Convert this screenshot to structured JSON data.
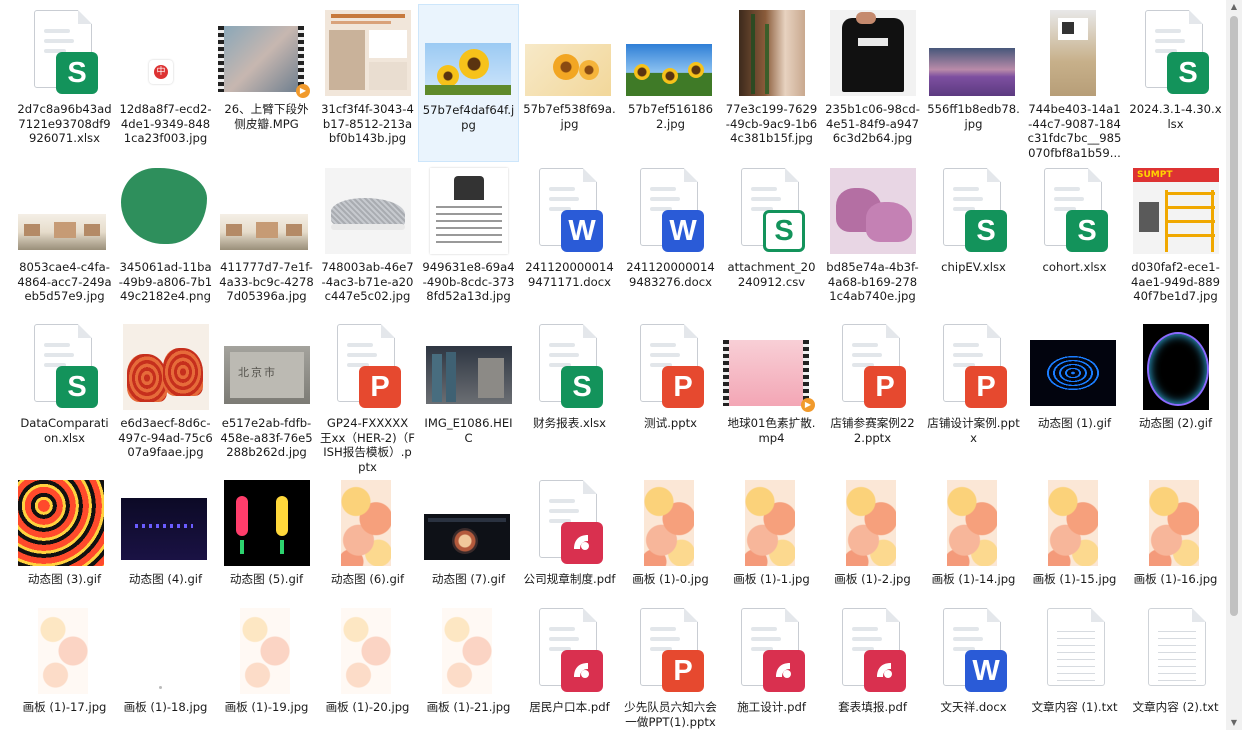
{
  "rows": [
    [
      {
        "name": "2d7c8a96b43ad7121e93708df9926071.xlsx",
        "kind": "xlsx"
      },
      {
        "name": "12d8a8f7-ecd2-4de1-9349-8481ca23f003.jpg",
        "kind": "img-seal"
      },
      {
        "name": "26、上臂下段外侧皮瓣.MPG",
        "kind": "video-skin"
      },
      {
        "name": "31cf3f4f-3043-4b17-8512-213abf0b143b.jpg",
        "kind": "img-poster"
      },
      {
        "name": "57b7ef4daf64f.jpg",
        "kind": "img-sunflower",
        "selected": true
      },
      {
        "name": "57b7ef538f69a.jpg",
        "kind": "img-flowers"
      },
      {
        "name": "57b7ef5161862.jpg",
        "kind": "img-sunfield"
      },
      {
        "name": "77e3c199-7629-49cb-9ac9-1b64c381b15f.jpg",
        "kind": "img-plant"
      },
      {
        "name": "235b1c06-98cd-4e51-84f9-a9476c3d2b64.jpg",
        "kind": "img-tshirt"
      },
      {
        "name": "556ff1b8edb78.jpg",
        "kind": "img-lavender"
      },
      {
        "name": "744be403-14a1-44c7-9087-184c31fdc7bc__985070fbf8a1b59...",
        "kind": "img-package"
      },
      {
        "name": "2024.3.1-4.30.xlsx",
        "kind": "xlsx"
      }
    ],
    [
      {
        "name": "8053cae4-c4fa-4864-acc7-249aeb5d57e9.jpg",
        "kind": "img-building"
      },
      {
        "name": "345061ad-11ba-49b9-a806-7b149c2182e4.png",
        "kind": "img-green"
      },
      {
        "name": "411777d7-7e1f-4a33-bc9c-42787d05396a.jpg",
        "kind": "img-building"
      },
      {
        "name": "748003ab-46e7-4ac3-b71e-a20c447e5c02.jpg",
        "kind": "img-shoe"
      },
      {
        "name": "949631e8-69a4-490b-8cdc-3738fd52a13d.jpg",
        "kind": "img-chart"
      },
      {
        "name": "2411200000149471171.docx",
        "kind": "docx"
      },
      {
        "name": "2411200000149483276.docx",
        "kind": "docx"
      },
      {
        "name": "attachment_20240912.csv",
        "kind": "csv"
      },
      {
        "name": "bd85e74a-4b3f-4a68-b169-2781c4ab740e.jpg",
        "kind": "img-slipper"
      },
      {
        "name": "chipEV.xlsx",
        "kind": "xlsx"
      },
      {
        "name": "cohort.xlsx",
        "kind": "xlsx"
      },
      {
        "name": "d030faf2-ece1-4ae1-949d-88940f7be1d7.jpg",
        "kind": "img-shelf"
      }
    ],
    [
      {
        "name": "DataComparation.xlsx",
        "kind": "xlsx"
      },
      {
        "name": "e6d3aecf-8d6c-497c-94ad-75c607a9faae.jpg",
        "kind": "img-redshoes"
      },
      {
        "name": "e517e2ab-fdfb-458e-a83f-76e5288b262d.jpg",
        "kind": "img-stone"
      },
      {
        "name": "GP24-FXXXXX 王xx（HER-2)（FISH报告模板）.pptx",
        "kind": "pptx"
      },
      {
        "name": "IMG_E1086.HEIC",
        "kind": "img-warehouse"
      },
      {
        "name": "财务报表.xlsx",
        "kind": "xlsx"
      },
      {
        "name": "测试.pptx",
        "kind": "pptx"
      },
      {
        "name": "地球01色素扩散.mp4",
        "kind": "video-pink"
      },
      {
        "name": "店铺参赛案例222.pptx",
        "kind": "pptx"
      },
      {
        "name": "店铺设计案例.pptx",
        "kind": "pptx"
      },
      {
        "name": "动态图 (1).gif",
        "kind": "img-ripple"
      },
      {
        "name": "动态图 (2).gif",
        "kind": "img-bubble"
      }
    ],
    [
      {
        "name": "动态图 (3).gif",
        "kind": "img-hex"
      },
      {
        "name": "动态图 (4).gif",
        "kind": "img-dots"
      },
      {
        "name": "动态图 (5).gif",
        "kind": "img-figures"
      },
      {
        "name": "动态图 (6).gif",
        "kind": "img-coral"
      },
      {
        "name": "动态图 (7).gif",
        "kind": "img-screen"
      },
      {
        "name": "公司规章制度.pdf",
        "kind": "pdf"
      },
      {
        "name": "画板 (1)-0.jpg",
        "kind": "img-coral"
      },
      {
        "name": "画板 (1)-1.jpg",
        "kind": "img-coral"
      },
      {
        "name": "画板 (1)-2.jpg",
        "kind": "img-coral"
      },
      {
        "name": "画板 (1)-14.jpg",
        "kind": "img-coral"
      },
      {
        "name": "画板 (1)-15.jpg",
        "kind": "img-coral"
      },
      {
        "name": "画板 (1)-16.jpg",
        "kind": "img-coral"
      }
    ],
    [
      {
        "name": "画板 (1)-17.jpg",
        "kind": "img-coral-light"
      },
      {
        "name": "画板 (1)-18.jpg",
        "kind": "img-blank"
      },
      {
        "name": "画板 (1)-19.jpg",
        "kind": "img-coral-light"
      },
      {
        "name": "画板 (1)-20.jpg",
        "kind": "img-coral-light"
      },
      {
        "name": "画板 (1)-21.jpg",
        "kind": "img-coral-light"
      },
      {
        "name": "居民户口本.pdf",
        "kind": "pdf"
      },
      {
        "name": "少先队员六知六会一做PPT(1).pptx",
        "kind": "pptx"
      },
      {
        "name": "施工设计.pdf",
        "kind": "pdf"
      },
      {
        "name": "套表填报.pdf",
        "kind": "pdf"
      },
      {
        "name": "文天祥.docx",
        "kind": "docx"
      },
      {
        "name": "文章内容 (1).txt",
        "kind": "txt"
      },
      {
        "name": "文章内容 (2).txt",
        "kind": "txt"
      }
    ]
  ],
  "badges": {
    "xlsx": {
      "letter": "S",
      "color": "#13935b"
    },
    "csv": {
      "letter": "S",
      "color": "#13935b"
    },
    "docx": {
      "letter": "W",
      "color": "#2a5bd7"
    },
    "pptx": {
      "letter": "P",
      "color": "#e6492f"
    },
    "pdf": {
      "letter": "⌀",
      "color": "#d9304f"
    }
  }
}
